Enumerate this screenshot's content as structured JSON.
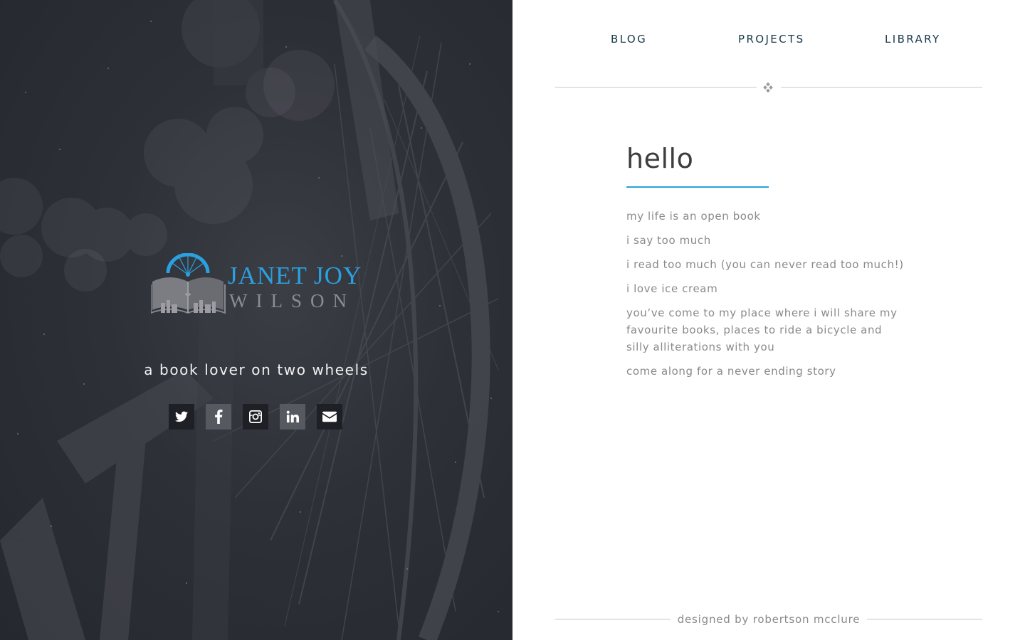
{
  "hero": {
    "brand": {
      "line1": "JANET JOY",
      "line2": "WILSON"
    },
    "tagline": "a book lover on two wheels",
    "socials": [
      {
        "icon": "twitter-icon"
      },
      {
        "icon": "facebook-icon"
      },
      {
        "icon": "instagram-icon"
      },
      {
        "icon": "linkedin-icon"
      },
      {
        "icon": "email-icon"
      }
    ]
  },
  "nav": {
    "items": [
      "BLOG",
      "PROJECTS",
      "LIBRARY"
    ]
  },
  "main": {
    "heading": "hello",
    "lines": [
      "my life is an open book",
      "i say too much",
      "i read too much (you can never read too much!)",
      "i love ice cream",
      "you’ve come to my place where i will share my favourite books, places to ride a bicycle and silly alliterations with you",
      "come along for a never ending story"
    ]
  },
  "footer": {
    "credit": "designed by robertson mcclure"
  },
  "colors": {
    "accent": "#2aa0de",
    "nav_text": "#16384a",
    "body_text": "#8a8a8a",
    "hero_bg": "#2e3038"
  }
}
